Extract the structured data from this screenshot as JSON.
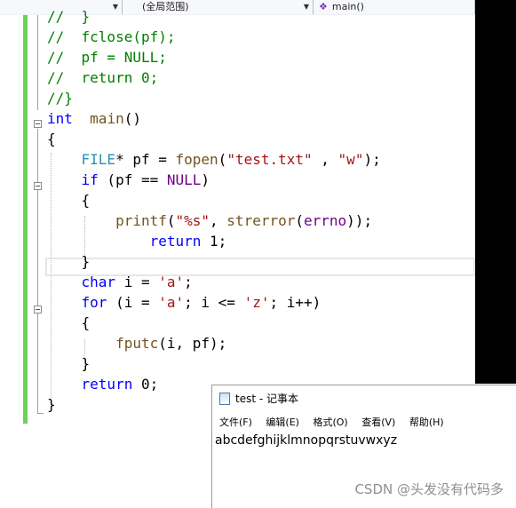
{
  "navbar": {
    "project_combo": "",
    "scope_combo": "(全局范围)",
    "function_combo": "main()"
  },
  "code_lines": [
    {
      "id": "l0",
      "tokens": [
        [
          "c",
          "//  }"
        ]
      ]
    },
    {
      "id": "l1",
      "tokens": [
        [
          "c",
          "//  fclose(pf);"
        ]
      ]
    },
    {
      "id": "l2",
      "tokens": [
        [
          "c",
          "//  pf = NULL;"
        ]
      ]
    },
    {
      "id": "l3",
      "tokens": [
        [
          "c",
          "//  return 0;"
        ]
      ]
    },
    {
      "id": "l4",
      "tokens": [
        [
          "c",
          "//}"
        ]
      ]
    },
    {
      "id": "l5",
      "tokens": [
        [
          "k",
          "int"
        ],
        [
          "",
          "  "
        ],
        [
          "f",
          "main"
        ],
        [
          "",
          "()"
        ]
      ]
    },
    {
      "id": "l6",
      "tokens": [
        [
          "",
          "{"
        ]
      ]
    },
    {
      "id": "l7",
      "tokens": [
        [
          "",
          "    "
        ],
        [
          "t",
          "FILE"
        ],
        [
          "",
          "* pf = "
        ],
        [
          "f",
          "fopen"
        ],
        [
          "",
          "("
        ],
        [
          "s",
          "\"test.txt\""
        ],
        [
          "",
          " , "
        ],
        [
          "s",
          "\"w\""
        ],
        [
          "",
          ");"
        ]
      ]
    },
    {
      "id": "l8",
      "tokens": [
        [
          "",
          "    "
        ],
        [
          "k",
          "if"
        ],
        [
          "",
          " (pf == "
        ],
        [
          "m",
          "NULL"
        ],
        [
          "",
          ")"
        ]
      ]
    },
    {
      "id": "l9",
      "tokens": [
        [
          "",
          "    {"
        ]
      ]
    },
    {
      "id": "l10",
      "tokens": [
        [
          "",
          "        "
        ],
        [
          "f",
          "printf"
        ],
        [
          "",
          "("
        ],
        [
          "s",
          "\"%s\""
        ],
        [
          "",
          ", "
        ],
        [
          "f",
          "strerror"
        ],
        [
          "",
          "("
        ],
        [
          "m",
          "errno"
        ],
        [
          "",
          "));"
        ]
      ]
    },
    {
      "id": "l11",
      "tokens": [
        [
          "",
          "            "
        ],
        [
          "k",
          "return"
        ],
        [
          "",
          " 1;"
        ]
      ]
    },
    {
      "id": "l12",
      "tokens": [
        [
          "",
          "    }"
        ]
      ]
    },
    {
      "id": "l13",
      "tokens": [
        [
          "",
          "    "
        ],
        [
          "k",
          "char"
        ],
        [
          "",
          " i = "
        ],
        [
          "s",
          "'a'"
        ],
        [
          "",
          ";"
        ]
      ]
    },
    {
      "id": "l14",
      "tokens": [
        [
          "",
          "    "
        ],
        [
          "k",
          "for"
        ],
        [
          "",
          " (i = "
        ],
        [
          "s",
          "'a'"
        ],
        [
          "",
          "; i <= "
        ],
        [
          "s",
          "'z'"
        ],
        [
          "",
          "; i++)"
        ]
      ]
    },
    {
      "id": "l15",
      "tokens": [
        [
          "",
          "    {"
        ]
      ]
    },
    {
      "id": "l16",
      "tokens": [
        [
          "",
          "        "
        ],
        [
          "f",
          "fputc"
        ],
        [
          "",
          "(i, pf);"
        ]
      ]
    },
    {
      "id": "l17",
      "tokens": [
        [
          "",
          "    }"
        ]
      ]
    },
    {
      "id": "l18",
      "tokens": [
        [
          "",
          "    "
        ],
        [
          "k",
          "return"
        ],
        [
          "",
          " 0;"
        ]
      ]
    },
    {
      "id": "l19",
      "tokens": [
        [
          "",
          "}"
        ]
      ]
    }
  ],
  "notepad": {
    "title": "test - 记事本",
    "menu": [
      "文件(F)",
      "编辑(E)",
      "格式(O)",
      "查看(V)",
      "帮助(H)"
    ],
    "content": "abcdefghijklmnopqrstuvwxyz"
  },
  "watermark": "CSDN @头发没有代码多",
  "colors": {
    "keyword": "#0000ff",
    "type": "#2b91af",
    "string": "#a31515",
    "macro": "#6f008a",
    "comment": "#008000",
    "function": "#74531f",
    "change_bar": "#68d357"
  }
}
